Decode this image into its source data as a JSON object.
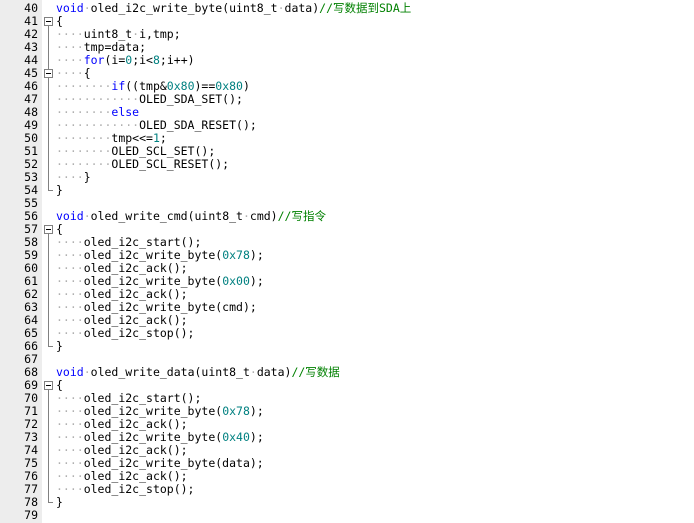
{
  "colors": {
    "keyword": "#0000ff",
    "number": "#008080",
    "comment": "#008000",
    "text": "#000000",
    "whitespace_marker": "#b0b0b0"
  },
  "lines": [
    {
      "n": "40",
      "fold": "none",
      "tokens": [
        [
          "kw",
          "void"
        ],
        [
          "ws",
          "·"
        ],
        [
          "plain",
          "oled_i2c_write_byte(uint8_t"
        ],
        [
          "ws",
          "·"
        ],
        [
          "plain",
          "data)"
        ],
        [
          "cmt",
          "//写数据到SDA上"
        ]
      ]
    },
    {
      "n": "41",
      "fold": "start",
      "tokens": [
        [
          "plain",
          "{"
        ]
      ]
    },
    {
      "n": "42",
      "fold": "mid",
      "tokens": [
        [
          "ws",
          "····"
        ],
        [
          "plain",
          "uint8_t"
        ],
        [
          "ws",
          "·"
        ],
        [
          "plain",
          "i,tmp;"
        ]
      ]
    },
    {
      "n": "43",
      "fold": "mid",
      "tokens": [
        [
          "ws",
          "····"
        ],
        [
          "plain",
          "tmp=data;"
        ]
      ]
    },
    {
      "n": "44",
      "fold": "mid",
      "tokens": [
        [
          "ws",
          "····"
        ],
        [
          "kw",
          "for"
        ],
        [
          "plain",
          "(i="
        ],
        [
          "num",
          "0"
        ],
        [
          "plain",
          ";i<"
        ],
        [
          "num",
          "8"
        ],
        [
          "plain",
          ";i++)"
        ]
      ]
    },
    {
      "n": "45",
      "fold": "inner-start",
      "tokens": [
        [
          "ws",
          "····"
        ],
        [
          "plain",
          "{"
        ]
      ]
    },
    {
      "n": "46",
      "fold": "mid",
      "tokens": [
        [
          "ws",
          "········"
        ],
        [
          "kw",
          "if"
        ],
        [
          "plain",
          "((tmp&"
        ],
        [
          "num",
          "0x80"
        ],
        [
          "plain",
          ")=="
        ],
        [
          "num",
          "0x80"
        ],
        [
          "plain",
          ")"
        ]
      ]
    },
    {
      "n": "47",
      "fold": "mid",
      "tokens": [
        [
          "ws",
          "············"
        ],
        [
          "plain",
          "OLED_SDA_SET();"
        ]
      ]
    },
    {
      "n": "48",
      "fold": "mid",
      "tokens": [
        [
          "ws",
          "········"
        ],
        [
          "kw",
          "else"
        ]
      ]
    },
    {
      "n": "49",
      "fold": "mid",
      "tokens": [
        [
          "ws",
          "············"
        ],
        [
          "plain",
          "OLED_SDA_RESET();"
        ]
      ]
    },
    {
      "n": "50",
      "fold": "mid",
      "tokens": [
        [
          "ws",
          "········"
        ],
        [
          "plain",
          "tmp<<="
        ],
        [
          "num",
          "1"
        ],
        [
          "plain",
          ";"
        ]
      ]
    },
    {
      "n": "51",
      "fold": "mid",
      "tokens": [
        [
          "ws",
          "········"
        ],
        [
          "plain",
          "OLED_SCL_SET();"
        ]
      ]
    },
    {
      "n": "52",
      "fold": "mid",
      "tokens": [
        [
          "ws",
          "········"
        ],
        [
          "plain",
          "OLED_SCL_RESET();"
        ]
      ]
    },
    {
      "n": "53",
      "fold": "mid",
      "tokens": [
        [
          "ws",
          "····"
        ],
        [
          "plain",
          "}"
        ]
      ]
    },
    {
      "n": "54",
      "fold": "end",
      "tokens": [
        [
          "plain",
          "}"
        ]
      ]
    },
    {
      "n": "55",
      "fold": "none",
      "tokens": []
    },
    {
      "n": "56",
      "fold": "none",
      "tokens": [
        [
          "kw",
          "void"
        ],
        [
          "ws",
          "·"
        ],
        [
          "plain",
          "oled_write_cmd(uint8_t"
        ],
        [
          "ws",
          "·"
        ],
        [
          "plain",
          "cmd)"
        ],
        [
          "cmt",
          "//写指令"
        ]
      ]
    },
    {
      "n": "57",
      "fold": "start",
      "tokens": [
        [
          "plain",
          "{"
        ]
      ]
    },
    {
      "n": "58",
      "fold": "mid",
      "tokens": [
        [
          "ws",
          "····"
        ],
        [
          "plain",
          "oled_i2c_start();"
        ]
      ]
    },
    {
      "n": "59",
      "fold": "mid",
      "tokens": [
        [
          "ws",
          "····"
        ],
        [
          "plain",
          "oled_i2c_write_byte("
        ],
        [
          "num",
          "0x78"
        ],
        [
          "plain",
          ");"
        ]
      ]
    },
    {
      "n": "60",
      "fold": "mid",
      "tokens": [
        [
          "ws",
          "····"
        ],
        [
          "plain",
          "oled_i2c_ack();"
        ]
      ]
    },
    {
      "n": "61",
      "fold": "mid",
      "tokens": [
        [
          "ws",
          "····"
        ],
        [
          "plain",
          "oled_i2c_write_byte("
        ],
        [
          "num",
          "0x00"
        ],
        [
          "plain",
          ");"
        ]
      ]
    },
    {
      "n": "62",
      "fold": "mid",
      "tokens": [
        [
          "ws",
          "····"
        ],
        [
          "plain",
          "oled_i2c_ack();"
        ]
      ]
    },
    {
      "n": "63",
      "fold": "mid",
      "tokens": [
        [
          "ws",
          "····"
        ],
        [
          "plain",
          "oled_i2c_write_byte(cmd);"
        ]
      ]
    },
    {
      "n": "64",
      "fold": "mid",
      "tokens": [
        [
          "ws",
          "····"
        ],
        [
          "plain",
          "oled_i2c_ack();"
        ]
      ]
    },
    {
      "n": "65",
      "fold": "mid",
      "tokens": [
        [
          "ws",
          "····"
        ],
        [
          "plain",
          "oled_i2c_stop();"
        ]
      ]
    },
    {
      "n": "66",
      "fold": "end",
      "tokens": [
        [
          "plain",
          "}"
        ]
      ]
    },
    {
      "n": "67",
      "fold": "none",
      "tokens": []
    },
    {
      "n": "68",
      "fold": "none",
      "tokens": [
        [
          "kw",
          "void"
        ],
        [
          "ws",
          "·"
        ],
        [
          "plain",
          "oled_write_data(uint8_t"
        ],
        [
          "ws",
          "·"
        ],
        [
          "plain",
          "data)"
        ],
        [
          "cmt",
          "//写数据"
        ]
      ]
    },
    {
      "n": "69",
      "fold": "start",
      "tokens": [
        [
          "plain",
          "{"
        ]
      ]
    },
    {
      "n": "70",
      "fold": "mid",
      "tokens": [
        [
          "ws",
          "····"
        ],
        [
          "plain",
          "oled_i2c_start();"
        ]
      ]
    },
    {
      "n": "71",
      "fold": "mid",
      "tokens": [
        [
          "ws",
          "····"
        ],
        [
          "plain",
          "oled_i2c_write_byte("
        ],
        [
          "num",
          "0x78"
        ],
        [
          "plain",
          ");"
        ]
      ]
    },
    {
      "n": "72",
      "fold": "mid",
      "tokens": [
        [
          "ws",
          "····"
        ],
        [
          "plain",
          "oled_i2c_ack();"
        ]
      ]
    },
    {
      "n": "73",
      "fold": "mid",
      "tokens": [
        [
          "ws",
          "····"
        ],
        [
          "plain",
          "oled_i2c_write_byte("
        ],
        [
          "num",
          "0x40"
        ],
        [
          "plain",
          ");"
        ]
      ]
    },
    {
      "n": "74",
      "fold": "mid",
      "tokens": [
        [
          "ws",
          "····"
        ],
        [
          "plain",
          "oled_i2c_ack();"
        ]
      ]
    },
    {
      "n": "75",
      "fold": "mid",
      "tokens": [
        [
          "ws",
          "····"
        ],
        [
          "plain",
          "oled_i2c_write_byte(data);"
        ]
      ]
    },
    {
      "n": "76",
      "fold": "mid",
      "tokens": [
        [
          "ws",
          "····"
        ],
        [
          "plain",
          "oled_i2c_ack();"
        ]
      ]
    },
    {
      "n": "77",
      "fold": "mid",
      "tokens": [
        [
          "ws",
          "····"
        ],
        [
          "plain",
          "oled_i2c_stop();"
        ]
      ]
    },
    {
      "n": "78",
      "fold": "end",
      "tokens": [
        [
          "plain",
          "}"
        ]
      ]
    },
    {
      "n": "79",
      "fold": "none",
      "tokens": []
    }
  ]
}
